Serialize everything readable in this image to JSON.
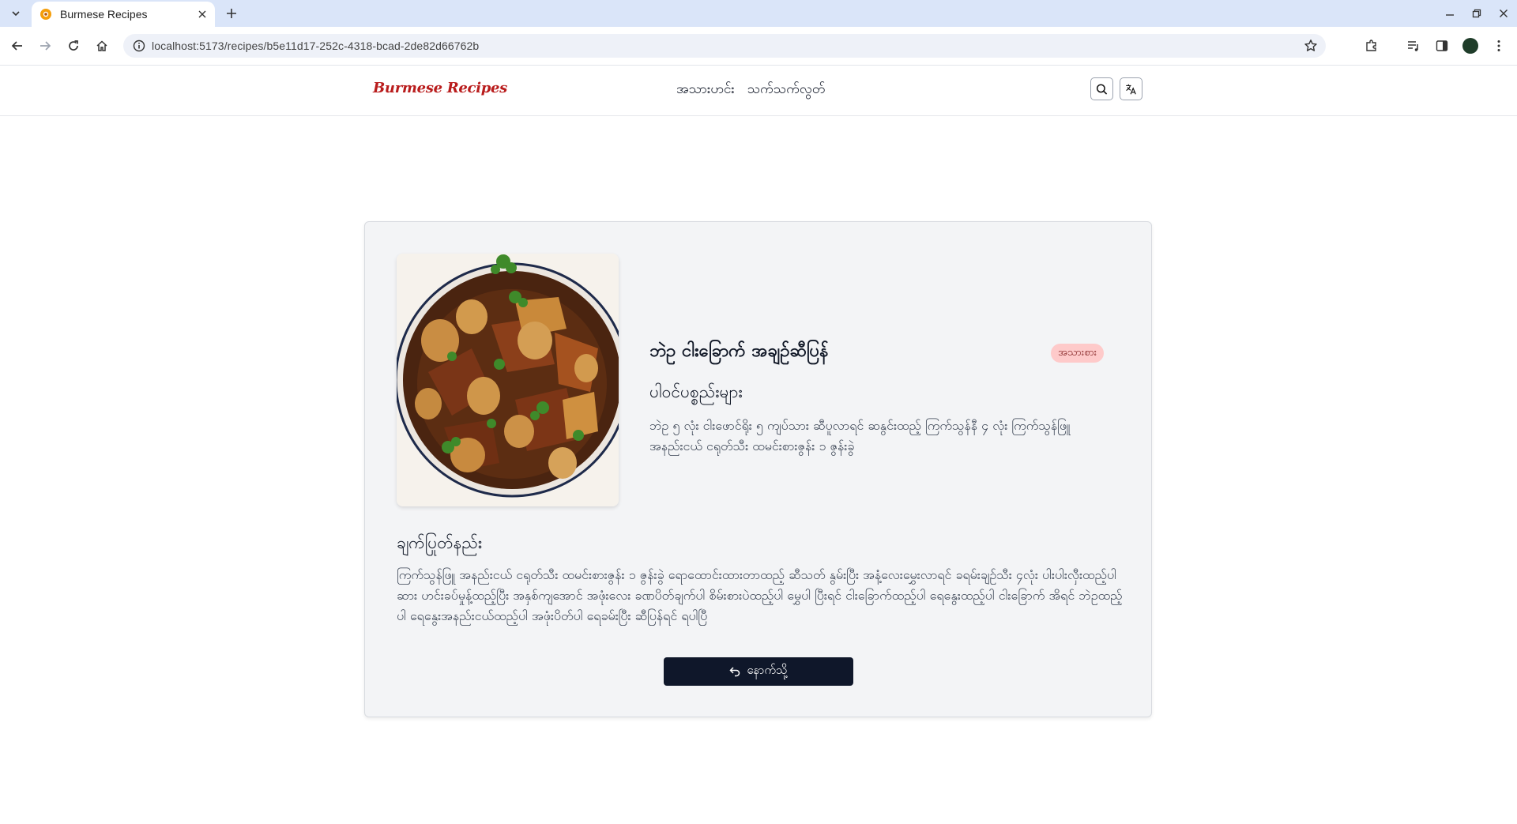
{
  "browser": {
    "tab_title": "Burmese Recipes",
    "url": "localhost:5173/recipes/b5e11d17-252c-4318-bcad-2de82d66762b"
  },
  "header": {
    "logo": "Burmese Recipes",
    "nav": [
      "အသားဟင်း",
      "သက်သက်လွတ်"
    ]
  },
  "recipe": {
    "title": "ဘဲဥ ငါးခြောက် အချဉ်ဆီပြန်",
    "category": "အသားစား",
    "ingredients_heading": "ပါဝင်ပစ္စည်းများ",
    "ingredients": "ဘဲဥ ၅ လုံး ငါးဖောင်ရိုး ၅ ကျပ်သား ဆီပူလာရင် ဆနွင်းထည့် ကြက်သွန်နီ ၄ လုံး ကြက်သွန်ဖြူ အနည်းငယ် ငရုတ်သီး ထမင်းစားဇွန်း ၁ ဇွန်းခွဲ",
    "instructions_heading": "ချက်ပြုတ်နည်း",
    "instructions": "ကြက်သွန်ဖြူ အနည်းငယ် ငရုတ်သီး ထမင်းစားဇွန်း ၁ ဇွန်းခွဲ ရောထောင်းထားတာထည့် ဆီသတ် နွမ်းပြီး အနံ့လေးမွှေးလာရင် ခရမ်းချဉ်သီး ၄လုံး ပါးပါးလှီးထည့်ပါ ဆား ဟင်းခပ်မှုန့်ထည့်ပြီး အနှစ်ကျအောင် အဖုံးလေး ခဏပိတ်ချက်ပါ စိမ်းစားပဲထည့်ပါ မွှေပါ ပြီးရင် ငါးခြောက်ထည့်ပါ ရေနွေးထည့်ပါ ငါးခြောက် အိရင် ဘဲဥထည့်ပါ ရေနွေးအနည်းငယ်ထည့်ပါ အဖုံးပိတ်ပါ ရေခမ်းပြီး ဆီပြန်ရင် ရပါပြီ",
    "back_label": "နောက်သို့"
  }
}
